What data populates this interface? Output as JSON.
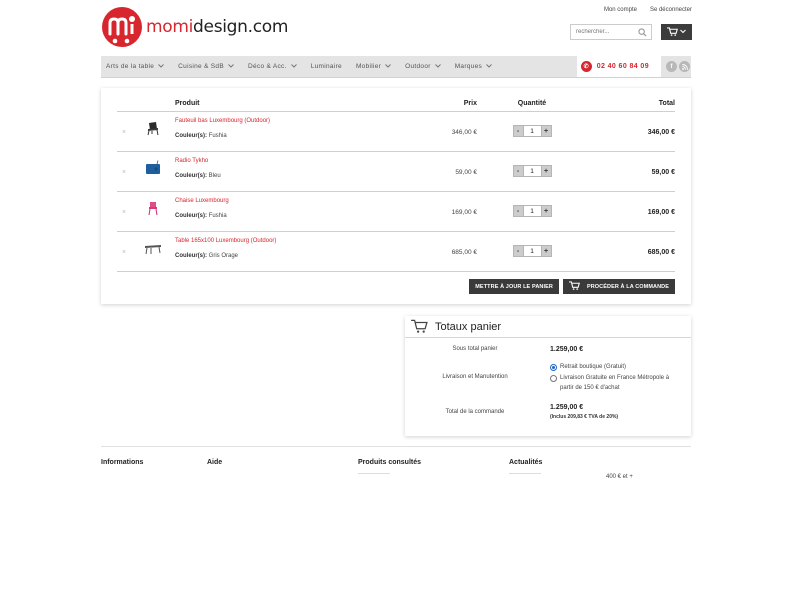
{
  "header": {
    "logo_part1": "momi",
    "logo_part2": "design",
    "logo_part3": ".com",
    "top_links": [
      "Mon compte",
      "Se déconnecter"
    ],
    "search_placeholder": "rechercher..."
  },
  "nav": {
    "items": [
      {
        "label": "Arts de la table",
        "dropdown": true
      },
      {
        "label": "Cuisine & SdB",
        "dropdown": true
      },
      {
        "label": "Déco & Acc.",
        "dropdown": true
      },
      {
        "label": "Luminaire",
        "dropdown": false
      },
      {
        "label": "Mobilier",
        "dropdown": true
      },
      {
        "label": "Outdoor",
        "dropdown": true
      },
      {
        "label": "Marques",
        "dropdown": true
      }
    ],
    "phone": "02 40 60 84 09"
  },
  "cart": {
    "headers": {
      "product": "Produit",
      "price": "Prix",
      "quantity": "Quantité",
      "total": "Total"
    },
    "items": [
      {
        "name": "Fauteuil bas Luxembourg (Outdoor)",
        "option_label": "Couleur(s):",
        "option_value": "Fushia",
        "price": "346,00 €",
        "qty": "1",
        "total": "346,00 €",
        "thumb": "chair-dark"
      },
      {
        "name": "Radio Tykho",
        "option_label": "Couleur(s):",
        "option_value": "Bleu",
        "price": "59,00 €",
        "qty": "1",
        "total": "59,00 €",
        "thumb": "radio-blue"
      },
      {
        "name": "Chaise Luxembourg",
        "option_label": "Couleur(s):",
        "option_value": "Fushia",
        "price": "169,00 €",
        "qty": "1",
        "total": "169,00 €",
        "thumb": "chair-pink"
      },
      {
        "name": "Table 165x100 Luxembourg (Outdoor)",
        "option_label": "Couleur(s):",
        "option_value": "Gris Orage",
        "price": "685,00 €",
        "qty": "1",
        "total": "685,00 €",
        "thumb": "table-grey"
      }
    ],
    "remove_symbol": "×",
    "minus": "-",
    "plus": "+",
    "update_label": "METTRE À JOUR LE PANIER",
    "checkout_label": "PROCÉDER À LA COMMANDE"
  },
  "totals": {
    "title": "Totaux panier",
    "subtotal_label": "Sous total panier",
    "subtotal_value": "1.259,00 €",
    "shipping_label": "Livraison et Manutention",
    "shipping_option1": "Retrait boutique (Gratuit)",
    "shipping_option2": "Livraison Gratuite en France Métropole à partir de 150 € d'achat",
    "shipping_selected": 1,
    "order_total_label": "Total de la commande",
    "order_total_value": "1.259,00 €",
    "vat_note": "(Inclus 209,83 € TVA de 20%)"
  },
  "footer": {
    "col1": "Informations",
    "col2": "Aide",
    "col3": "Produits consultés",
    "col4": "Actualités",
    "price_range": "400 € et +"
  },
  "colors": {
    "accent": "#d8262e",
    "dark": "#3a3a3a",
    "radio": "#1e66c8"
  }
}
